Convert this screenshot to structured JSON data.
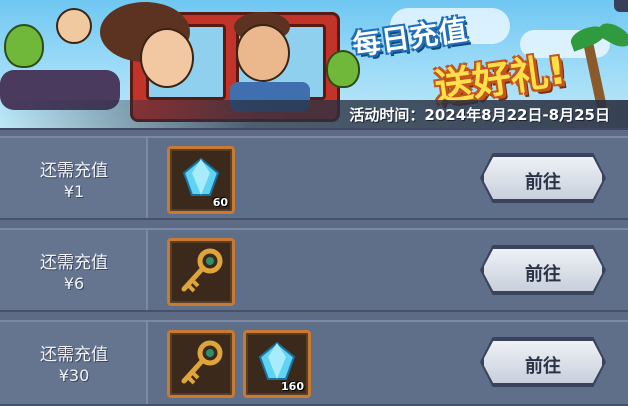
{
  "banner": {
    "title_line1": "每日充值",
    "title_line2": "送好礼!",
    "event_time": "活动时间：2024年8月22日-8月25日"
  },
  "tiers": [
    {
      "requirement_label": "还需充值",
      "amount": "¥1",
      "rewards": [
        {
          "icon": "diamond-icon",
          "count": "60"
        }
      ],
      "button_label": "前往"
    },
    {
      "requirement_label": "还需充值",
      "amount": "¥6",
      "rewards": [
        {
          "icon": "key-icon",
          "count": ""
        }
      ],
      "button_label": "前往"
    },
    {
      "requirement_label": "还需充值",
      "amount": "¥30",
      "rewards": [
        {
          "icon": "key-icon",
          "count": ""
        },
        {
          "icon": "diamond-icon",
          "count": "160"
        }
      ],
      "button_label": "前往"
    }
  ],
  "colors": {
    "panel": "#5f6e89",
    "item_border": "#c97a32",
    "button_face": "#e6eaf1",
    "title_yellow": "#ffe04a"
  }
}
